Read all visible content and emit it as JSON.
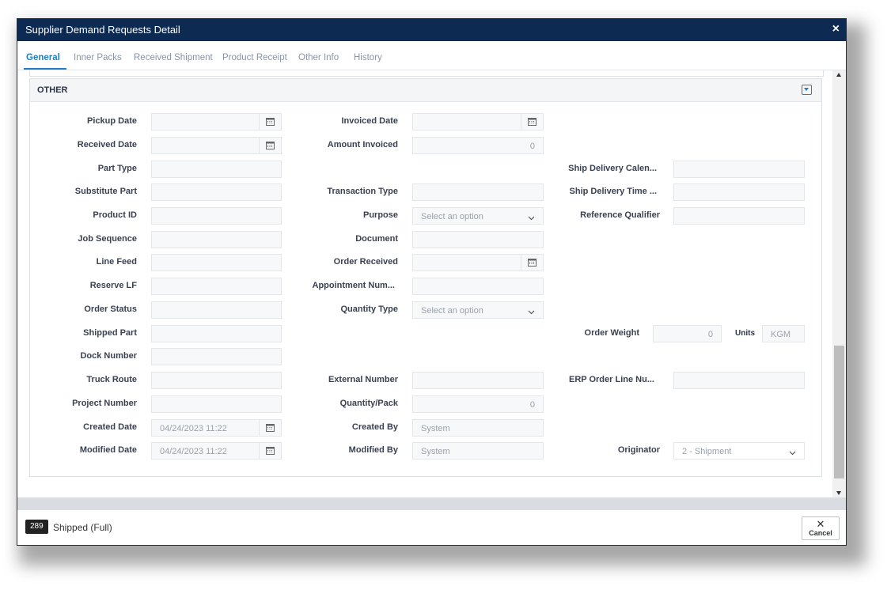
{
  "dialog": {
    "title": "Supplier Demand Requests Detail",
    "close_icon": "×"
  },
  "tabs": [
    "General",
    "Inner Packs",
    "Received Shipment",
    "Product Receipt",
    "Other Info",
    "History"
  ],
  "section": {
    "title": "OTHER"
  },
  "fields": {
    "pickup_date": {
      "label": "Pickup Date",
      "value": ""
    },
    "received_date": {
      "label": "Received Date",
      "value": ""
    },
    "part_type": {
      "label": "Part Type",
      "value": ""
    },
    "substitute_part": {
      "label": "Substitute Part",
      "value": ""
    },
    "product_id": {
      "label": "Product ID",
      "value": ""
    },
    "job_sequence": {
      "label": "Job Sequence",
      "value": ""
    },
    "line_feed": {
      "label": "Line Feed",
      "value": ""
    },
    "reserve_lf": {
      "label": "Reserve LF",
      "value": ""
    },
    "order_status": {
      "label": "Order Status",
      "value": ""
    },
    "shipped_part": {
      "label": "Shipped Part",
      "value": ""
    },
    "dock_number": {
      "label": "Dock Number",
      "value": ""
    },
    "truck_route": {
      "label": "Truck Route",
      "value": ""
    },
    "project_number": {
      "label": "Project Number",
      "value": ""
    },
    "created_date": {
      "label": "Created Date",
      "value": "04/24/2023 11:22"
    },
    "modified_date": {
      "label": "Modified Date",
      "value": "04/24/2023 11:22"
    },
    "invoiced_date": {
      "label": "Invoiced Date",
      "value": ""
    },
    "amount_invoiced": {
      "label": "Amount Invoiced",
      "value": "0"
    },
    "transaction_type": {
      "label": "Transaction Type",
      "value": ""
    },
    "purpose": {
      "label": "Purpose",
      "placeholder": "Select an option"
    },
    "document": {
      "label": "Document",
      "value": ""
    },
    "order_received": {
      "label": "Order Received",
      "value": ""
    },
    "appointment_num": {
      "label": "Appointment Num...",
      "value": ""
    },
    "quantity_type": {
      "label": "Quantity Type",
      "placeholder": "Select an option"
    },
    "external_number": {
      "label": "External Number",
      "value": ""
    },
    "quantity_pack": {
      "label": "Quantity/Pack",
      "value": "0"
    },
    "created_by": {
      "label": "Created By",
      "value": "System"
    },
    "modified_by": {
      "label": "Modified By",
      "value": "System"
    },
    "ship_delivery_calen": {
      "label": "Ship Delivery Calen...",
      "value": ""
    },
    "ship_delivery_time": {
      "label": "Ship Delivery Time ...",
      "value": ""
    },
    "reference_qualifier": {
      "label": "Reference Qualifier",
      "value": ""
    },
    "order_weight": {
      "label": "Order Weight",
      "value": "0"
    },
    "units": {
      "label": "Units",
      "value": "KGM"
    },
    "erp_order_line": {
      "label": "ERP Order Line Nu...",
      "value": ""
    },
    "originator": {
      "label": "Originator",
      "value": "2 - Shipment"
    }
  },
  "footer": {
    "badge": "289",
    "status": "Shipped (Full)",
    "cancel_label": "Cancel"
  },
  "colors": {
    "titlebar": "#0d2a52",
    "accent": "#1f7fc9"
  }
}
